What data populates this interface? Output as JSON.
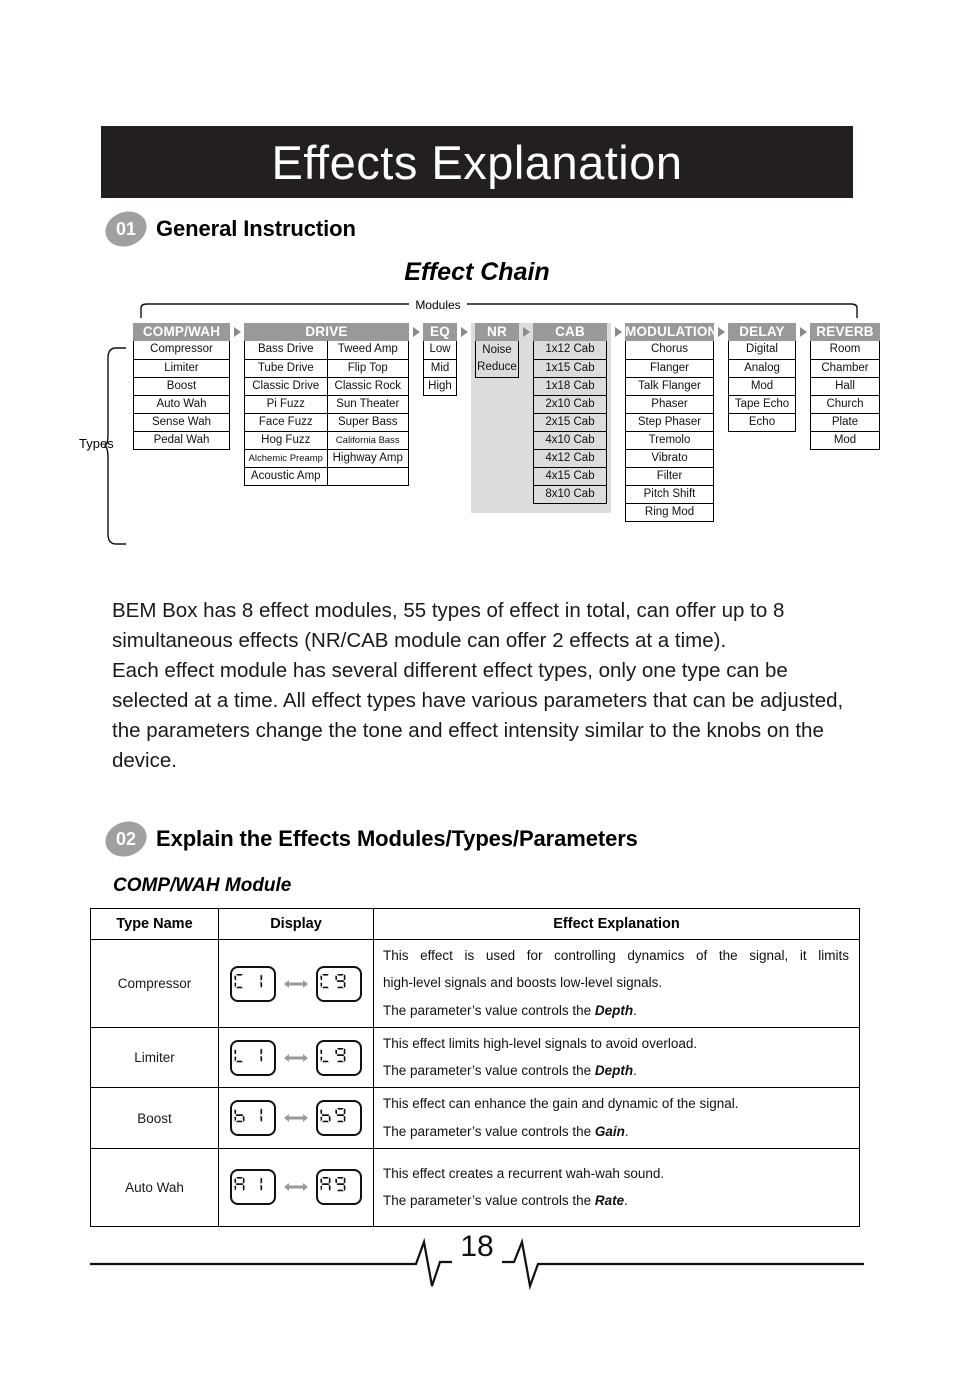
{
  "banner": {
    "title": "Effects Explanation"
  },
  "sections": [
    {
      "number": "01",
      "title": "General Instruction"
    },
    {
      "number": "02",
      "title": "Explain the Effects Modules/Types/Parameters"
    }
  ],
  "chain": {
    "heading": "Effect Chain",
    "modules_label": "Modules",
    "types_label": "Types",
    "modules": [
      {
        "name": "COMP/WAH",
        "columns": 1,
        "types": [
          "Compressor",
          "Limiter",
          "Boost",
          "Auto Wah",
          "Sense Wah",
          "Pedal Wah"
        ]
      },
      {
        "name": "DRIVE",
        "columns": 2,
        "types": [
          "Bass Drive",
          "Tweed Amp",
          "Tube Drive",
          "Flip Top",
          "Classic Drive",
          "Classic Rock",
          "Pi Fuzz",
          "Sun Theater",
          "Face Fuzz",
          "Super Bass",
          "Hog Fuzz",
          "California Bass",
          "Alchemic Preamp",
          "Highway Amp",
          "Acoustic Amp",
          ""
        ]
      },
      {
        "name": "EQ",
        "columns": 1,
        "types": [
          "Low",
          "Mid",
          "High"
        ]
      },
      {
        "name": "NR",
        "columns": 1,
        "types": [
          "Noise Reduce"
        ]
      },
      {
        "name": "CAB",
        "columns": 1,
        "types": [
          "1x12 Cab",
          "1x15 Cab",
          "1x18 Cab",
          "2x10 Cab",
          "2x15 Cab",
          "4x10 Cab",
          "4x12 Cab",
          "4x15 Cab",
          "8x10 Cab"
        ]
      },
      {
        "name": "MODULATION",
        "columns": 1,
        "types": [
          "Chorus",
          "Flanger",
          "Talk Flanger",
          "Phaser",
          "Step Phaser",
          "Tremolo",
          "Vibrato",
          "Filter",
          "Pitch Shift",
          "Ring Mod"
        ]
      },
      {
        "name": "DELAY",
        "columns": 1,
        "types": [
          "Digital",
          "Analog",
          "Mod",
          "Tape Echo",
          "Echo"
        ]
      },
      {
        "name": "REVERB",
        "columns": 1,
        "types": [
          "Room",
          "Chamber",
          "Hall",
          "Church",
          "Plate",
          "Mod"
        ]
      }
    ]
  },
  "body": {
    "paragraph1": "BEM Box has 8 effect modules, 55 types of effect in total, can offer up to 8 simultaneous effects (NR/CAB module can offer 2 effects at a time).",
    "paragraph2": "Each effect module has several different effect types, only one type can be selected at a time. All effect types have various parameters that can be adjusted, the parameters change the tone and effect intensity similar to the knobs on the device."
  },
  "module_subtitle": "COMP/WAH Module",
  "table": {
    "headers": [
      "Type Name",
      "Display",
      "Effect Explanation"
    ],
    "rows": [
      {
        "type": "Compressor",
        "display_from": "C1",
        "display_to": "C9",
        "lines": [
          "This effect is used for controlling dynamics of the signal, it limits",
          "high-level signals and boosts low-level signals."
        ],
        "param_prefix": "The parameter’s value controls the ",
        "param_name": "Depth",
        "param_suffix": "."
      },
      {
        "type": "Limiter",
        "display_from": "L1",
        "display_to": "L9",
        "lines": [
          "This effect limits high-level signals to avoid overload."
        ],
        "param_prefix": "The parameter’s value controls the ",
        "param_name": "Depth",
        "param_suffix": "."
      },
      {
        "type": "Boost",
        "display_from": "b1",
        "display_to": "b9",
        "lines": [
          "This effect can enhance the gain and dynamic of the signal."
        ],
        "param_prefix": "The parameter’s value controls the ",
        "param_name": "Gain",
        "param_suffix": "."
      },
      {
        "type": "Auto Wah",
        "display_from": "A1",
        "display_to": "A9",
        "lines": [
          "This effect creates a recurrent wah-wah sound."
        ],
        "param_prefix": "The parameter’s value controls the ",
        "param_name": "Rate",
        "param_suffix": "."
      }
    ]
  },
  "footer": {
    "page_number": "18"
  },
  "colors": {
    "banner_bg": "#231f20",
    "header_gray": "#999999",
    "badge_gray": "#a0a0a0",
    "nrcab_bg": "#dcdcdc",
    "arrow_gray": "#8a8a8a"
  }
}
